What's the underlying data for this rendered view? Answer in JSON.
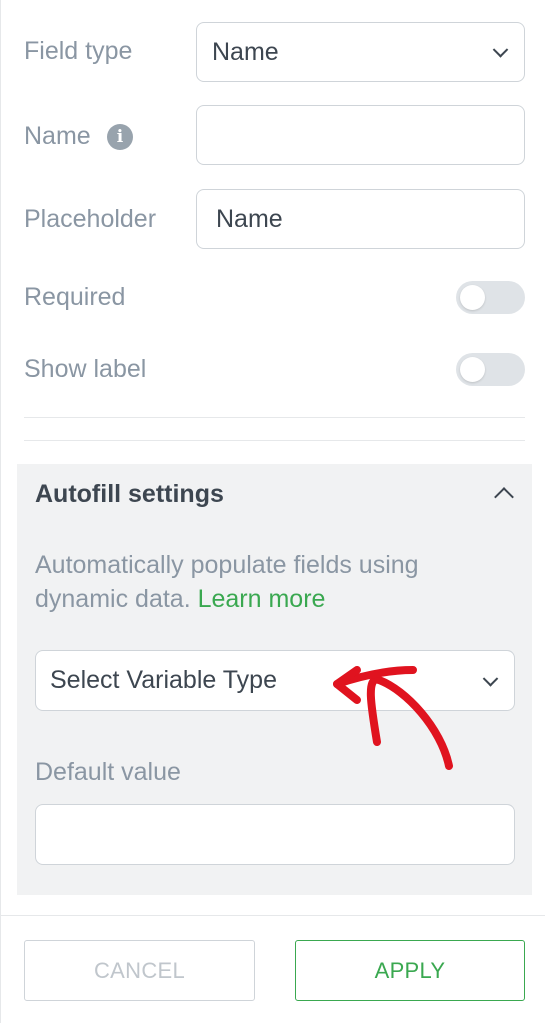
{
  "form": {
    "field_type": {
      "label": "Field type",
      "value": "Name"
    },
    "name": {
      "label": "Name",
      "value": ""
    },
    "placeholder": {
      "label": "Placeholder",
      "value": "Name"
    },
    "required": {
      "label": "Required",
      "enabled": false
    },
    "show_label": {
      "label": "Show label",
      "enabled": false
    }
  },
  "autofill": {
    "title": "Autofill settings",
    "description": "Automatically populate fields using dynamic data.",
    "learn_more": "Learn more",
    "variable_select": {
      "placeholder": "Select Variable Type"
    },
    "default_value": {
      "label": "Default value",
      "value": ""
    }
  },
  "footer": {
    "cancel_label": "CANCEL",
    "apply_label": "APPLY"
  },
  "colors": {
    "accent_green": "#3aa850",
    "label_gray": "#8a96a3",
    "text_dark": "#3d4650",
    "annotation_red": "#e0131f"
  },
  "icons": [
    "info-icon",
    "chevron-down-icon",
    "chevron-up-icon",
    "arrow-annotation"
  ]
}
